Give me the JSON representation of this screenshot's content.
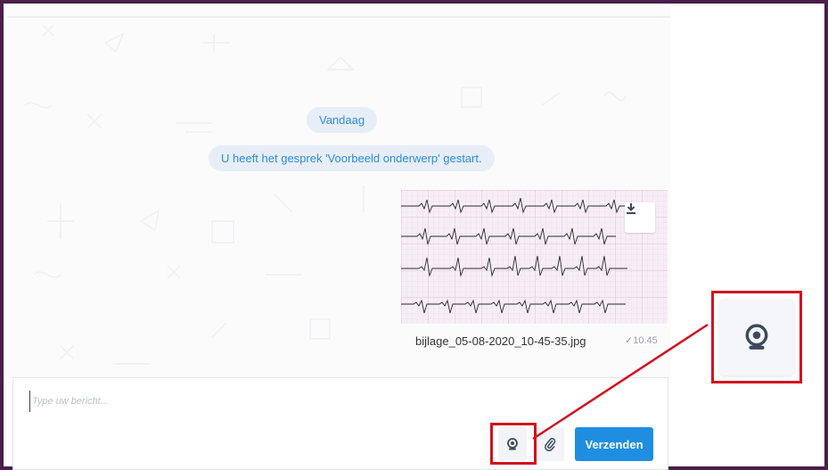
{
  "chat": {
    "date_separator": "Vandaag",
    "system_message": "U heeft het gesprek 'Voorbeeld onderwerp' gestart.",
    "attachment": {
      "file_name": "bijlage_05-08-2020_10-45-35.jpg",
      "time": "✓10.45",
      "download_icon": "download-icon"
    }
  },
  "composer": {
    "placeholder": "Type uw bericht...",
    "send_label": "Verzenden",
    "webcam_icon": "webcam-icon",
    "attach_icon": "paperclip-icon"
  },
  "colors": {
    "accent": "#1f8ee0",
    "pill_bg": "#e7eef8",
    "pill_text": "#2e8ed6",
    "highlight": "#d2121f",
    "frame": "#4a1f4a"
  }
}
